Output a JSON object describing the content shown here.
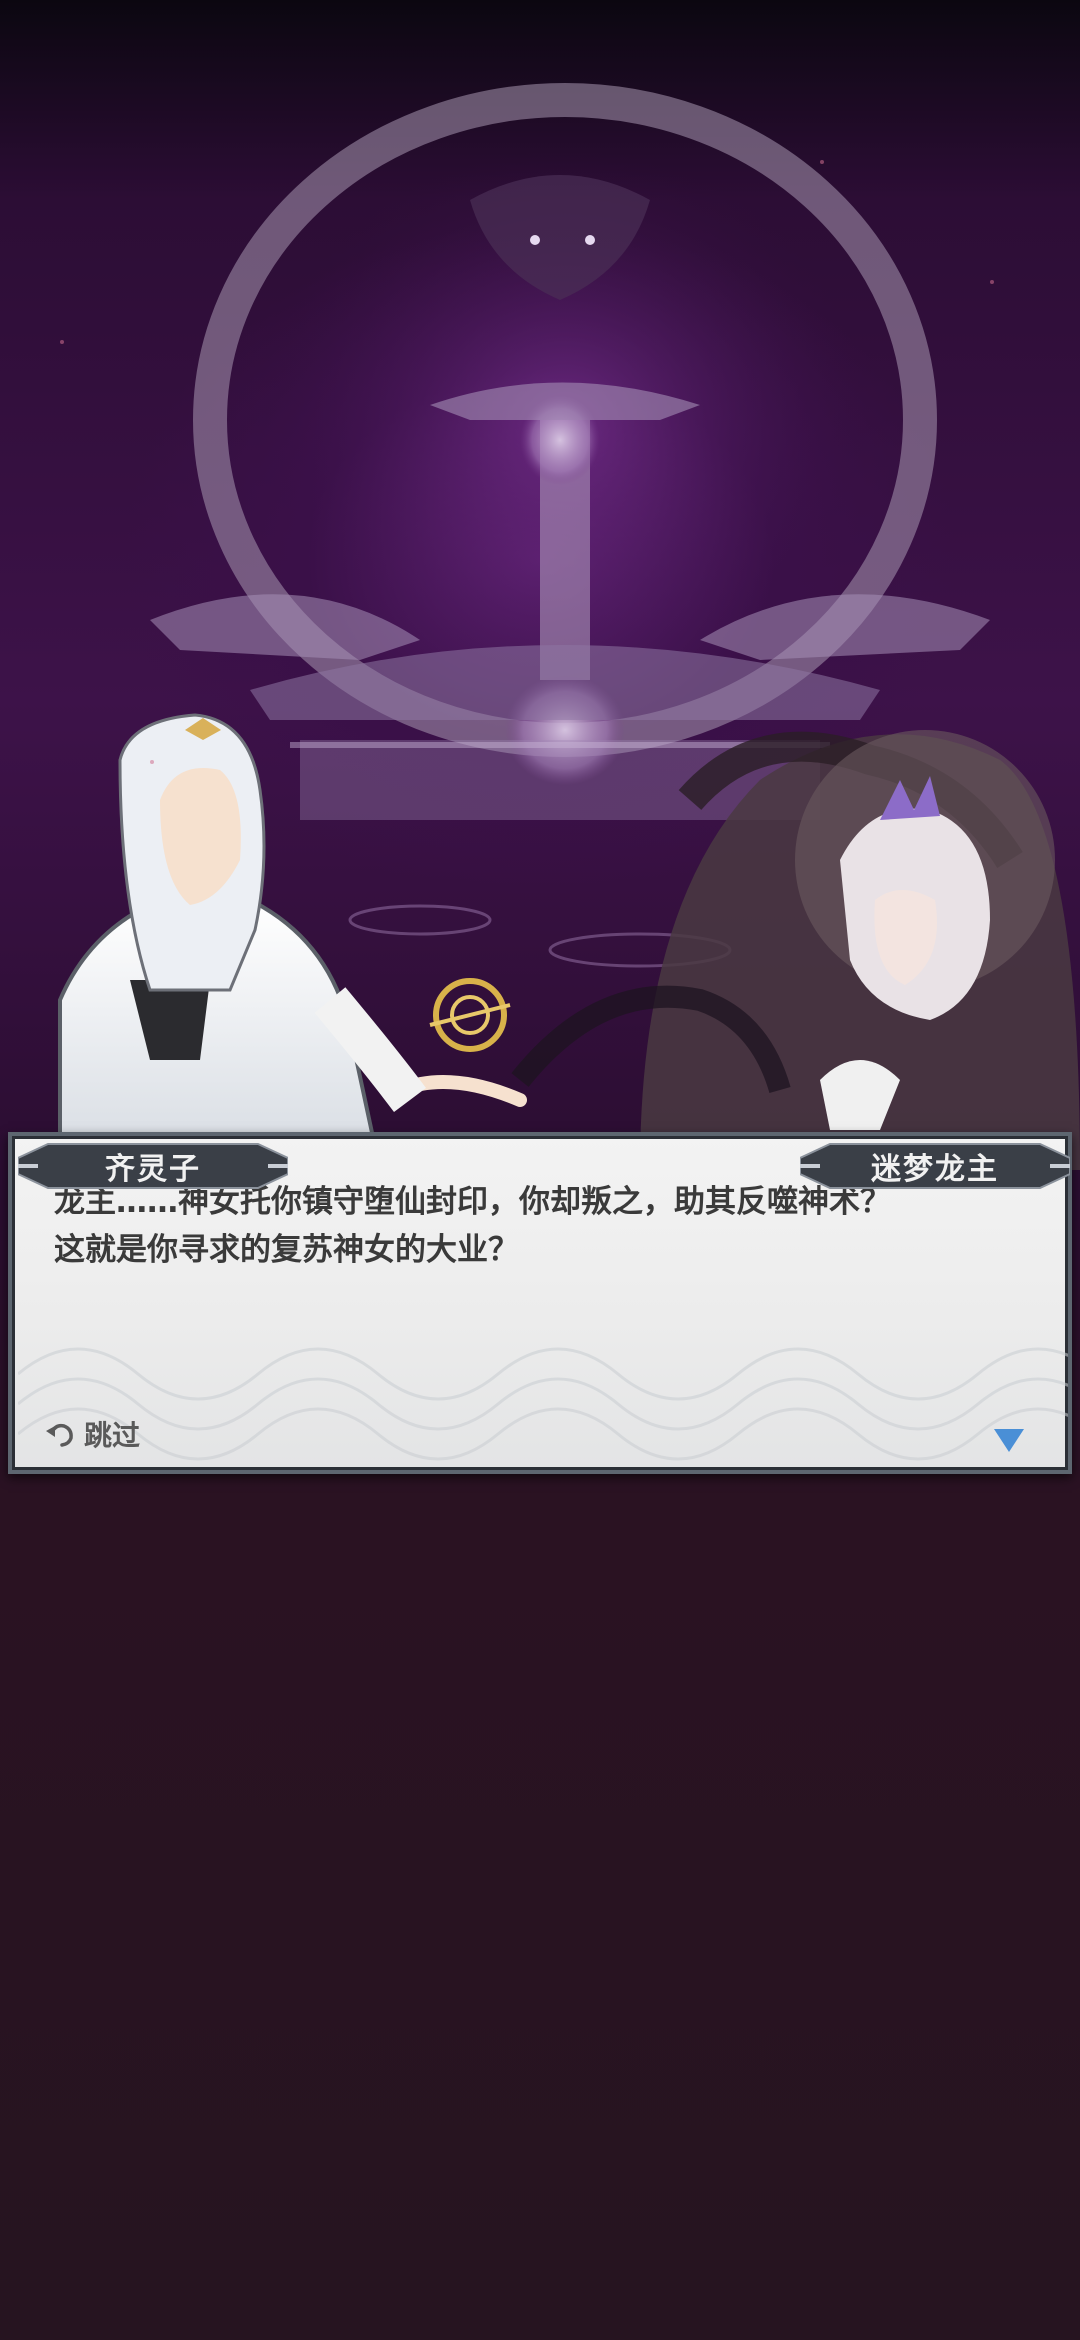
{
  "dialogue": {
    "speaker_left": "齐灵子",
    "speaker_right": "迷梦龙主",
    "text": "龙主……神女托你镇守堕仙封印，你却叛之，助其反噬神术？\n这就是你寻求的复苏神女的大业？",
    "skip_label": "跳过",
    "skip_icon": "undo-arrow-icon",
    "next_icon": "triangle-down-icon"
  },
  "colors": {
    "accent_blue": "#4a8fd6",
    "plate_dark": "#3a3f47",
    "text_dark": "#3a3a3a"
  }
}
